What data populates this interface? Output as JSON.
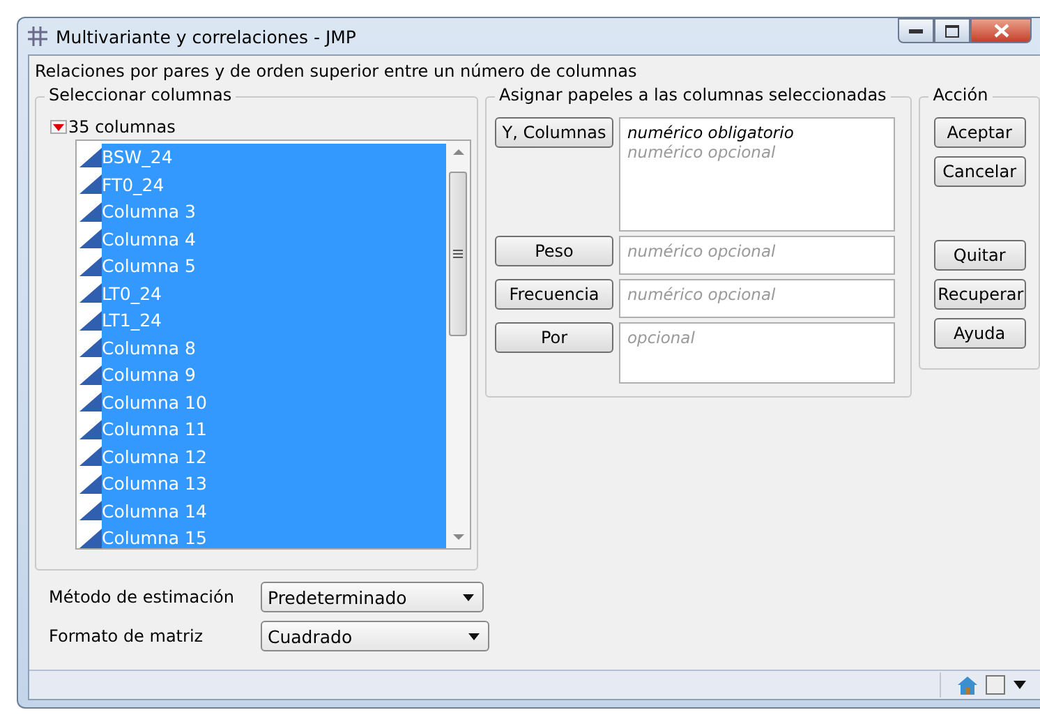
{
  "window": {
    "title": "Multivariante y correlaciones - JMP"
  },
  "description": "Relaciones por pares y de orden superior entre un número de columnas",
  "select_columns": {
    "title": "Seleccionar columnas",
    "count_label": "35 columnas",
    "columns": [
      {
        "name": "BSW_24",
        "selected": true
      },
      {
        "name": "FT0_24",
        "selected": true
      },
      {
        "name": "Columna 3",
        "selected": true
      },
      {
        "name": "Columna 4",
        "selected": true
      },
      {
        "name": "Columna 5",
        "selected": true
      },
      {
        "name": "LT0_24",
        "selected": true
      },
      {
        "name": "LT1_24",
        "selected": true
      },
      {
        "name": "Columna 8",
        "selected": true
      },
      {
        "name": "Columna 9",
        "selected": true
      },
      {
        "name": "Columna 10",
        "selected": true
      },
      {
        "name": "Columna 11",
        "selected": true
      },
      {
        "name": "Columna 12",
        "selected": true
      },
      {
        "name": "Columna 13",
        "selected": true
      },
      {
        "name": "Columna 14",
        "selected": true
      },
      {
        "name": "Columna 15",
        "selected": true
      }
    ]
  },
  "roles": {
    "title": "Asignar papeles a las columnas seleccionadas",
    "items": [
      {
        "button": "Y, Columnas",
        "hints": [
          {
            "text": "numérico obligatorio",
            "required": true
          },
          {
            "text": "numérico opcional",
            "required": false
          }
        ]
      },
      {
        "button": "Peso",
        "hints": [
          {
            "text": "numérico opcional",
            "required": false
          }
        ]
      },
      {
        "button": "Frecuencia",
        "hints": [
          {
            "text": "numérico opcional",
            "required": false
          }
        ]
      },
      {
        "button": "Por",
        "hints": [
          {
            "text": "opcional",
            "required": false
          }
        ]
      }
    ]
  },
  "action": {
    "title": "Acción",
    "buttons_top": [
      "Aceptar",
      "Cancelar"
    ],
    "buttons_bottom": [
      "Quitar",
      "Recuperar",
      "Ayuda"
    ]
  },
  "options": [
    {
      "label": "Método de estimación",
      "value": "Predeterminado"
    },
    {
      "label": "Formato de matriz",
      "value": "Cuadrado"
    }
  ]
}
